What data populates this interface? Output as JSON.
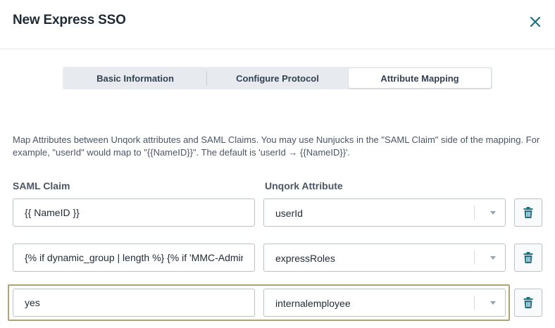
{
  "dialog": {
    "title": "New Express SSO"
  },
  "tabs": [
    {
      "label": "Basic Information",
      "active": false
    },
    {
      "label": "Configure Protocol",
      "active": false
    },
    {
      "label": "Attribute Mapping",
      "active": true
    }
  ],
  "description": "Map Attributes between Unqork attributes and SAML Claims. You may use Nunjucks in the \"SAML Claim\" side of the mapping. For example, \"userId\" would map to \"{{NameID}}\". The default is 'userId → {{NameID}}'.",
  "columns": {
    "saml_claim": "SAML Claim",
    "unqork_attribute": "Unqork Attribute"
  },
  "rows": [
    {
      "saml_claim": "{{ NameID }}",
      "unqork_attribute": "userId",
      "highlighted": false
    },
    {
      "saml_claim": "{% if dynamic_group | length %} {% if 'MMC-Admin' in dynamic_group %}",
      "unqork_attribute": "expressRoles",
      "highlighted": false
    },
    {
      "saml_claim": "yes",
      "unqork_attribute": "internalemployee",
      "highlighted": true
    }
  ],
  "colors": {
    "accent": "#1d6f83",
    "highlight_border": "#b1a273"
  },
  "icons": {
    "close": "close-icon",
    "delete": "trash-icon",
    "dropdown": "chevron-down-icon"
  }
}
